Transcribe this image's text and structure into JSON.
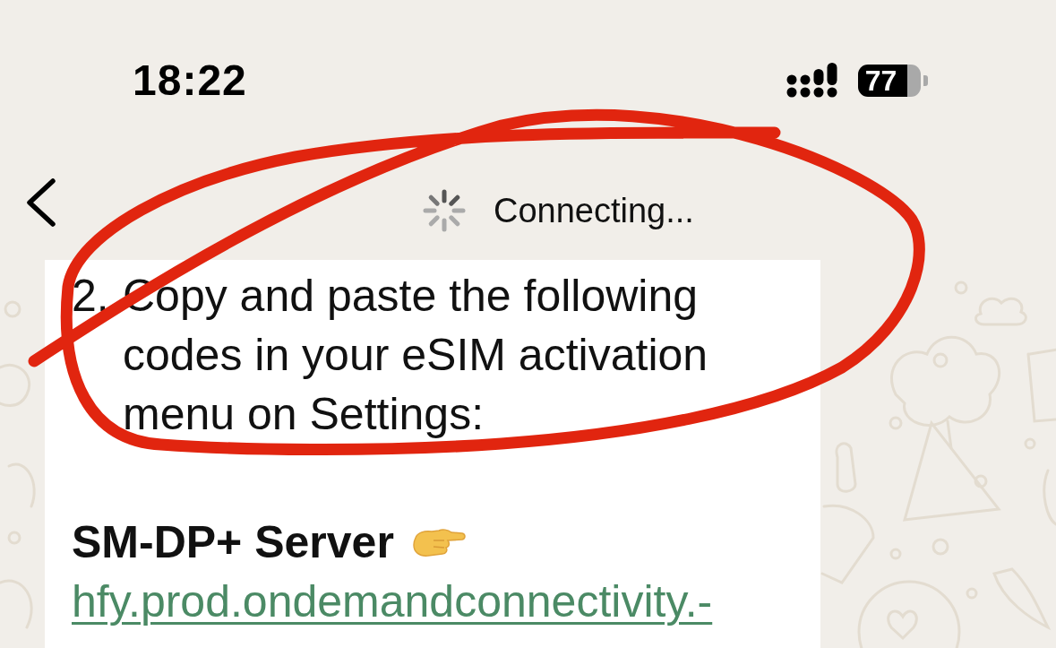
{
  "status_bar": {
    "time": "18:22",
    "battery": "77"
  },
  "nav_bar": {
    "title": "Connecting..."
  },
  "message": {
    "list_item": {
      "number": "2.",
      "text": "Copy and paste the following codes in your eSIM activation menu on Settings:"
    },
    "heading": "SM-DP+ Server",
    "link": "hfy.prod.ondemandconnectivity.-"
  }
}
